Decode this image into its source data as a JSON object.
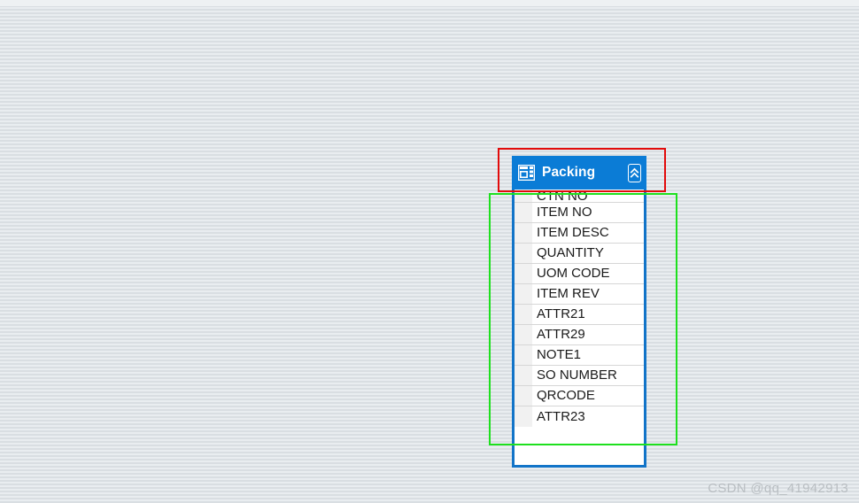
{
  "background": {
    "style": "horizontal-striped-gray",
    "color_light": "#e9edf0",
    "color_dark": "#d9dee2"
  },
  "annotations": [
    {
      "name": "red-highlight-rectangle",
      "color": "#e20b0b",
      "target": "panel-title-bar"
    },
    {
      "name": "green-highlight-rectangle",
      "color": "#1ee01e",
      "target": "panel-field-list"
    }
  ],
  "panel": {
    "title": "Packing",
    "title_icon": "table-form-icon",
    "collapse_icon": "double-chevron-up-icon",
    "header_color": "#0b7cd6",
    "border_color": "#1274c8",
    "fields": [
      {
        "label": "CTN NO"
      },
      {
        "label": "ITEM NO"
      },
      {
        "label": "ITEM DESC"
      },
      {
        "label": "QUANTITY"
      },
      {
        "label": "UOM CODE"
      },
      {
        "label": "ITEM REV"
      },
      {
        "label": "ATTR21"
      },
      {
        "label": "ATTR29"
      },
      {
        "label": "NOTE1"
      },
      {
        "label": "SO NUMBER"
      },
      {
        "label": "QRCODE"
      },
      {
        "label": "ATTR23"
      }
    ]
  },
  "watermark": {
    "text": "CSDN @qq_41942913"
  }
}
